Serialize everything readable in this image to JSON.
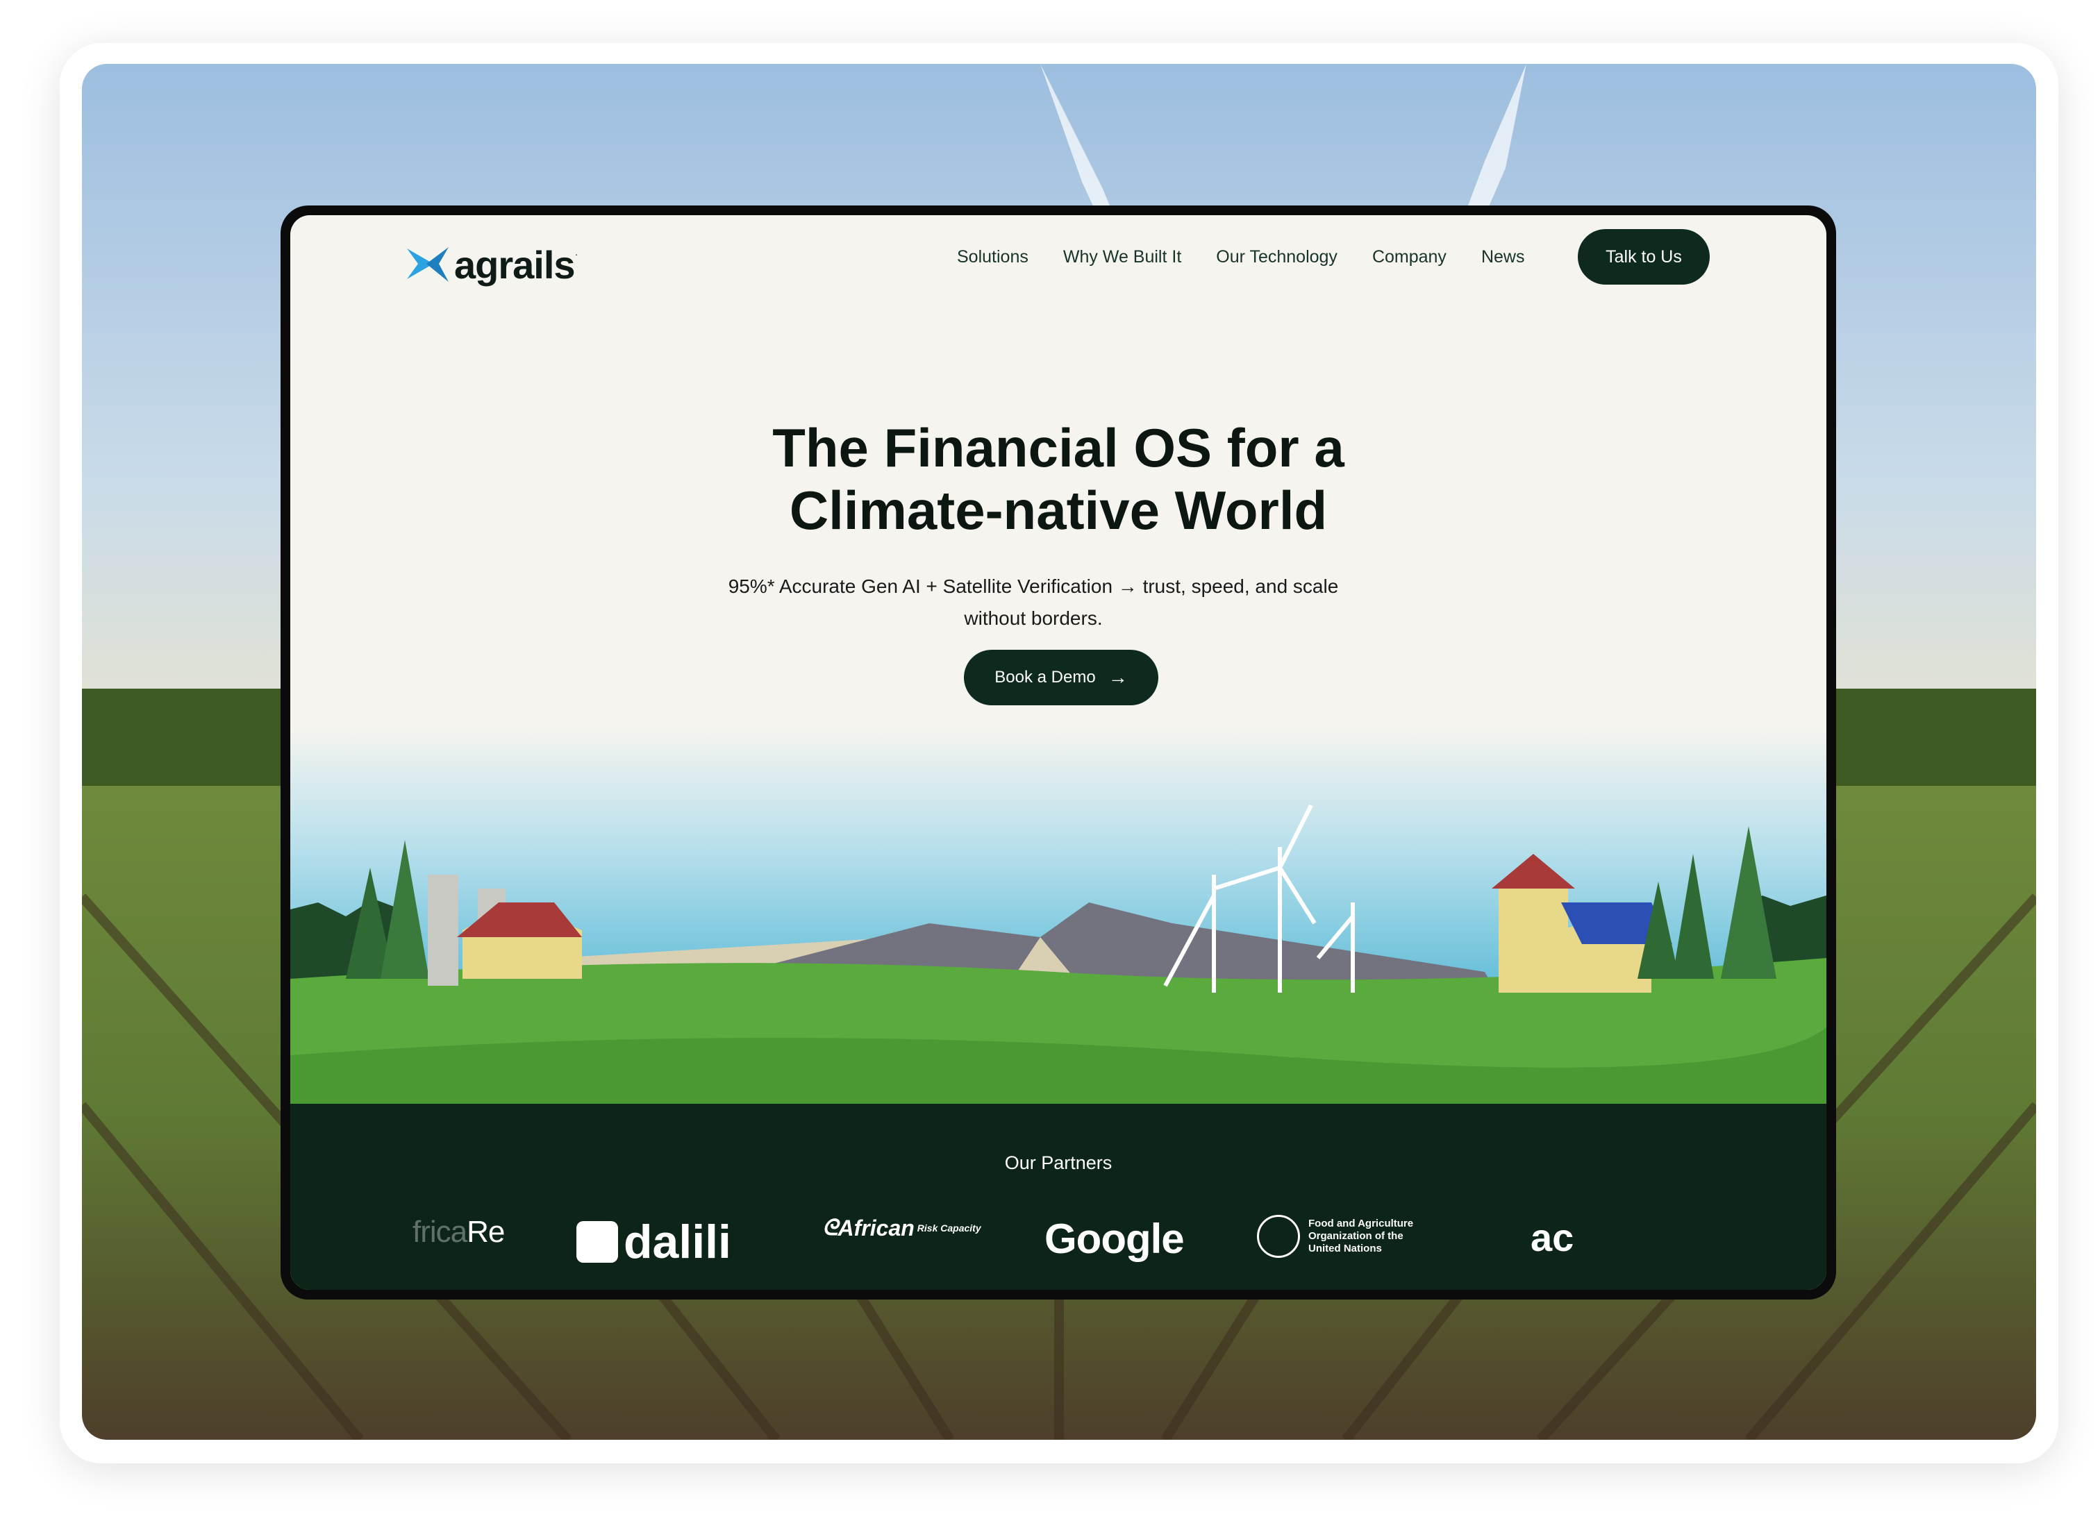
{
  "brand": {
    "name": "agrails",
    "mark": "·"
  },
  "nav": {
    "links": [
      "Solutions",
      "Why We Built It",
      "Our Technology",
      "Company",
      "News"
    ],
    "cta": "Talk to Us"
  },
  "hero": {
    "title_line1": "The Financial OS for a",
    "title_line2": "Climate-native World",
    "subtitle_line1": "95%* Accurate Gen AI + Satellite Verification → trust, speed, and scale",
    "subtitle_line2": "without borders.",
    "cta": "Book a Demo",
    "cta_icon": "arrow-right-icon"
  },
  "partners": {
    "title": "Our Partners",
    "logos": {
      "africare_faded": "frica",
      "africare_main": "Re",
      "dalili": "dalili",
      "african": "African",
      "african_sub": "Risk Capacity",
      "google": "Google",
      "fao_line1": "Food and Agriculture",
      "fao_line2": "Organization of the",
      "fao_line3": "United Nations",
      "ac": "ac"
    }
  },
  "colors": {
    "dark_green": "#0e2a1e",
    "page_bg": "#f5f4ef",
    "accent_blue": "#2aa3e0"
  }
}
